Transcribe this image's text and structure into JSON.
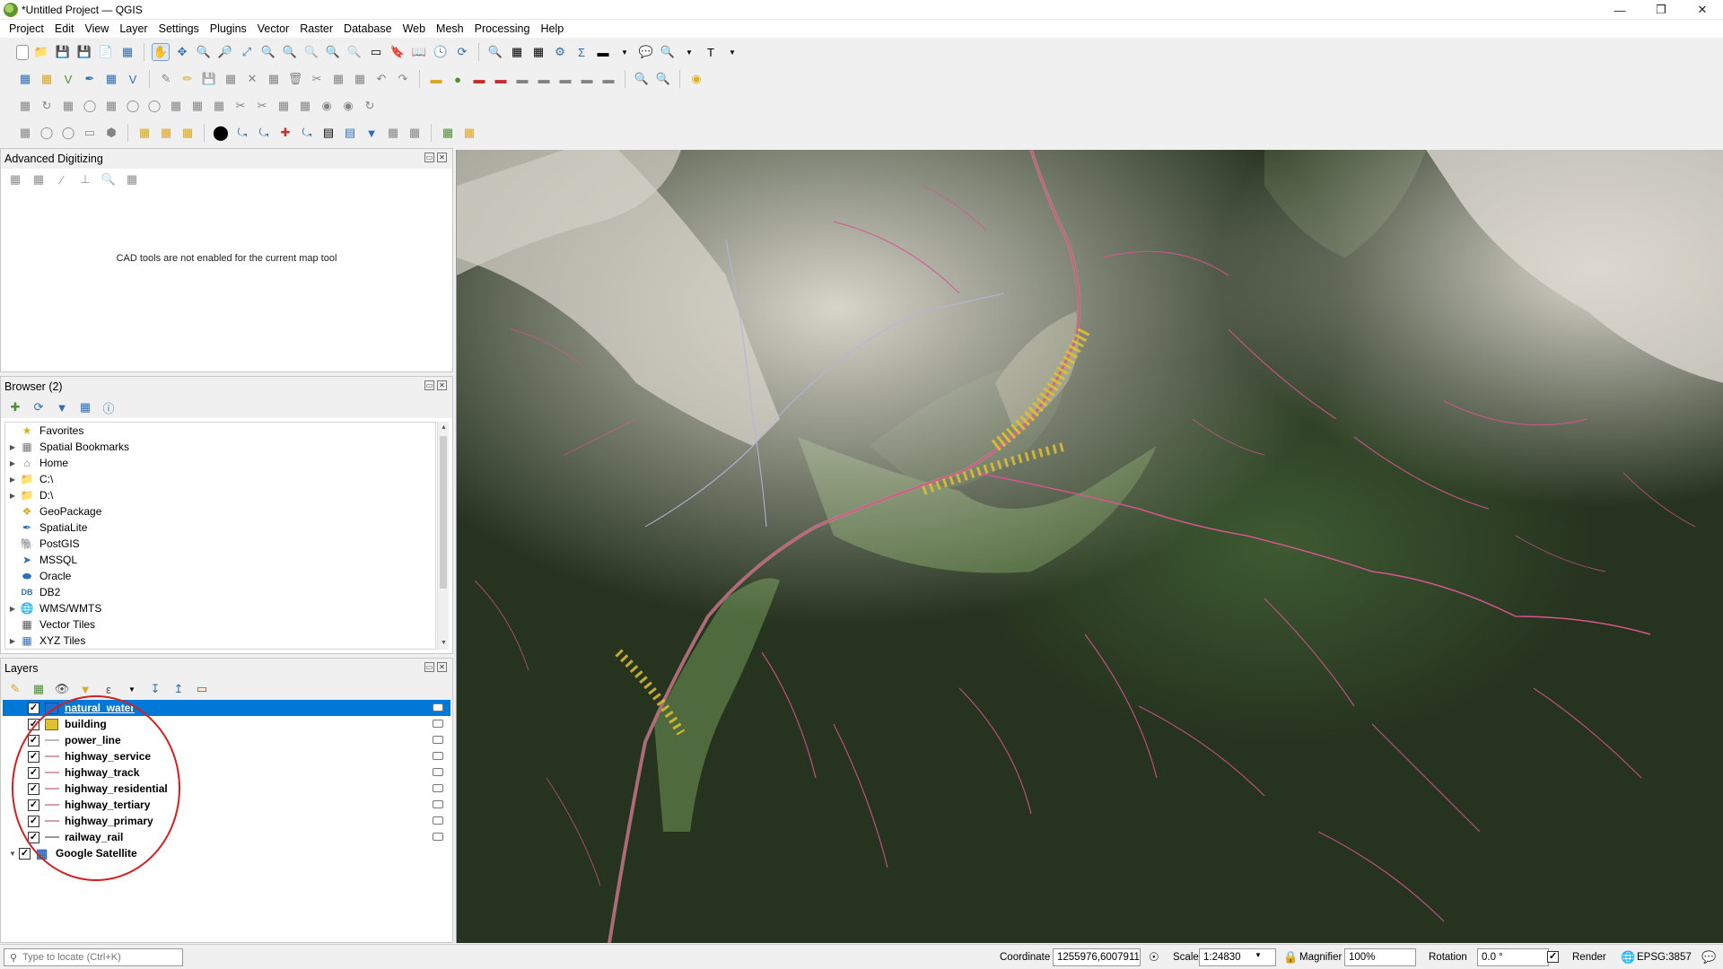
{
  "window": {
    "title": "*Untitled Project — QGIS",
    "controls": [
      "minimize",
      "restore",
      "close"
    ]
  },
  "menu": [
    "Project",
    "Edit",
    "View",
    "Layer",
    "Settings",
    "Plugins",
    "Vector",
    "Raster",
    "Database",
    "Web",
    "Mesh",
    "Processing",
    "Help"
  ],
  "adv_digitizing": {
    "title": "Advanced Digitizing",
    "message": "CAD tools are not enabled for the current map tool"
  },
  "browser": {
    "title": "Browser (2)",
    "items": [
      {
        "label": "Favorites",
        "icon": "star-icon",
        "expandable": false
      },
      {
        "label": "Spatial Bookmarks",
        "icon": "bookmark-icon",
        "expandable": true
      },
      {
        "label": "Home",
        "icon": "home-folder-icon",
        "expandable": true
      },
      {
        "label": "C:\\",
        "icon": "folder-icon",
        "expandable": true
      },
      {
        "label": "D:\\",
        "icon": "folder-icon",
        "expandable": true
      },
      {
        "label": "GeoPackage",
        "icon": "geopackage-icon",
        "expandable": false
      },
      {
        "label": "SpatiaLite",
        "icon": "spatialite-icon",
        "expandable": false
      },
      {
        "label": "PostGIS",
        "icon": "postgis-icon",
        "expandable": false
      },
      {
        "label": "MSSQL",
        "icon": "mssql-icon",
        "expandable": false
      },
      {
        "label": "Oracle",
        "icon": "oracle-icon",
        "expandable": false
      },
      {
        "label": "DB2",
        "icon": "db2-icon",
        "expandable": false
      },
      {
        "label": "WMS/WMTS",
        "icon": "wms-icon",
        "expandable": true
      },
      {
        "label": "Vector Tiles",
        "icon": "vector-tiles-icon",
        "expandable": false
      },
      {
        "label": "XYZ Tiles",
        "icon": "xyz-tiles-icon",
        "expandable": true
      }
    ]
  },
  "layers": {
    "title": "Layers",
    "items": [
      {
        "name": "natural_water",
        "type": "polygon",
        "color": "#1f6fd1",
        "checked": true,
        "selected": true
      },
      {
        "name": "building",
        "type": "polygon",
        "color": "#e1c030",
        "checked": true,
        "selected": false
      },
      {
        "name": "power_line",
        "type": "line",
        "color": "#b9b9c8",
        "checked": true,
        "selected": false
      },
      {
        "name": "highway_service",
        "type": "line",
        "color": "#d99cb5",
        "checked": true,
        "selected": false
      },
      {
        "name": "highway_track",
        "type": "line",
        "color": "#d99cb5",
        "checked": true,
        "selected": false
      },
      {
        "name": "highway_residential",
        "type": "line",
        "color": "#d99cb5",
        "checked": true,
        "selected": false
      },
      {
        "name": "highway_tertiary",
        "type": "line",
        "color": "#d99cb5",
        "checked": true,
        "selected": false
      },
      {
        "name": "highway_primary",
        "type": "line",
        "color": "#d99cb5",
        "checked": true,
        "selected": false
      },
      {
        "name": "railway_rail",
        "type": "line",
        "color": "#9a9a9a",
        "checked": true,
        "selected": false
      },
      {
        "name": "Google Satellite",
        "type": "raster",
        "color": "#2d6cc0",
        "checked": true,
        "selected": false
      }
    ]
  },
  "statusbar": {
    "locator_placeholder": "Type to locate (Ctrl+K)",
    "coordinate_label": "Coordinate",
    "coordinate_value": "1255976,6007911",
    "scale_label": "Scale",
    "scale_value": "1:24830",
    "magnifier_label": "Magnifier",
    "magnifier_value": "100%",
    "rotation_label": "Rotation",
    "rotation_value": "0.0 °",
    "render_label": "Render",
    "crs": "EPSG:3857"
  }
}
